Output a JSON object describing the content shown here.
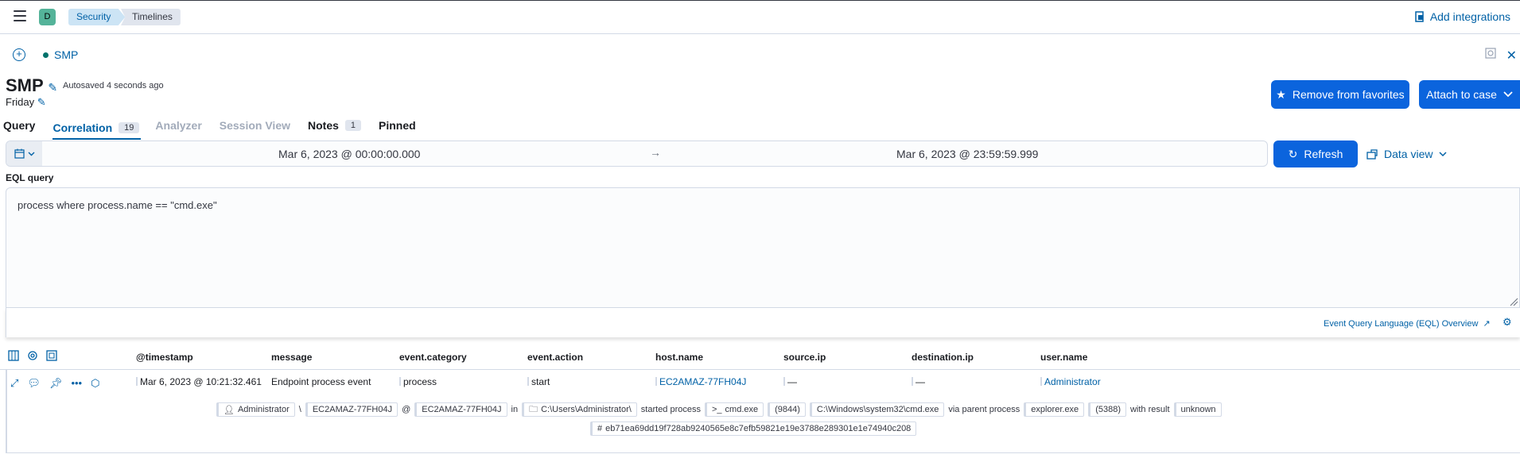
{
  "topbar": {
    "space_initial": "D",
    "breadcrumbs": [
      "Security",
      "Timelines"
    ],
    "add_integrations": "Add integrations"
  },
  "timeline_tab": {
    "name": "SMP"
  },
  "header": {
    "title": "SMP",
    "autosaved": "Autosaved 4 seconds ago",
    "description": "Friday",
    "favorites_button": "Remove from favorites",
    "attach_button": "Attach to case"
  },
  "tabs": [
    {
      "label": "Query"
    },
    {
      "label": "Correlation",
      "count": "19"
    },
    {
      "label": "Analyzer"
    },
    {
      "label": "Session View"
    },
    {
      "label": "Notes",
      "count": "1"
    },
    {
      "label": "Pinned"
    }
  ],
  "datepicker": {
    "start": "Mar 6, 2023 @ 00:00:00.000",
    "arrow": "→",
    "end": "Mar 6, 2023 @ 23:59:59.999",
    "refresh": "Refresh",
    "data_view": "Data view"
  },
  "eql": {
    "label": "EQL query",
    "query": "process where process.name == \"cmd.exe\"",
    "overview_link": "Event Query Language (EQL) Overview"
  },
  "table": {
    "columns": [
      "@timestamp",
      "message",
      "event.category",
      "event.action",
      "host.name",
      "source.ip",
      "destination.ip",
      "user.name"
    ],
    "row": {
      "timestamp": "Mar 6, 2023 @ 10:21:32.461",
      "message": "Endpoint process event",
      "category": "process",
      "action": "start",
      "host": "EC2AMAZ-77FH04J",
      "source_ip": "—",
      "destination_ip": "—",
      "user": "Administrator"
    },
    "summary": {
      "user": "Administrator",
      "sep1": "\\",
      "domain": "EC2AMAZ-77FH04J",
      "at": "@",
      "host": "EC2AMAZ-77FH04J",
      "in": "in",
      "working_dir": "C:\\Users\\Administrator\\",
      "started": "started process",
      "process": "cmd.exe",
      "pid": "(9844)",
      "executable": "C:\\Windows\\system32\\cmd.exe",
      "via": "via parent process",
      "parent": "explorer.exe",
      "ppid": "(5388)",
      "with_result": "with result",
      "result": "unknown",
      "hash": "eb71ea69dd19f728ab9240565e8c7efb59821e19e3788e289301e1e74940c208"
    }
  },
  "colors": {
    "primary": "#0b64dd",
    "link": "#0061a6",
    "space_badge": "#54b399",
    "border": "#d3dae6"
  }
}
